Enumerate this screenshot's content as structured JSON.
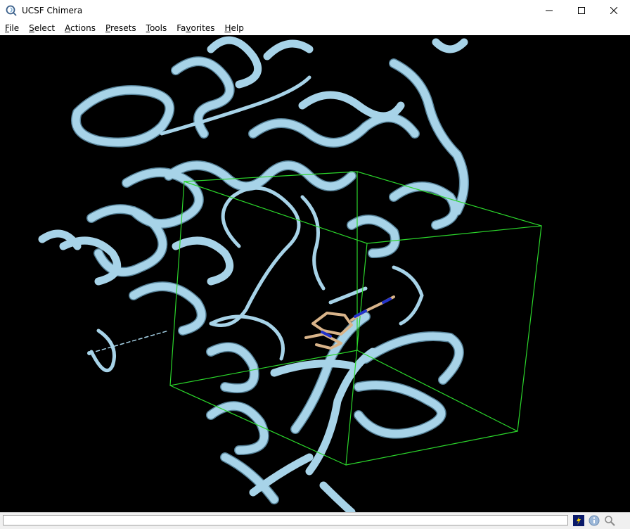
{
  "window": {
    "title": "UCSF Chimera",
    "icon": "chimera-logo-icon"
  },
  "window_controls": [
    "minimize-icon",
    "maximize-icon",
    "close-icon"
  ],
  "menu": {
    "items": [
      {
        "label": "File",
        "mnemonic": "F",
        "rest": "ile"
      },
      {
        "label": "Select",
        "mnemonic": "S",
        "rest": "elect"
      },
      {
        "label": "Actions",
        "mnemonic": "A",
        "rest": "ctions"
      },
      {
        "label": "Presets",
        "mnemonic": "P",
        "rest": "resets"
      },
      {
        "label": "Tools",
        "mnemonic": "T",
        "rest": "ools"
      },
      {
        "label": "Favorites",
        "pre": "Fa",
        "mnemonic": "v",
        "rest": "orites"
      },
      {
        "label": "Help",
        "mnemonic": "H",
        "rest": "elp"
      }
    ]
  },
  "viewer": {
    "background": "#000000",
    "ribbon_color": "#a7d3e8",
    "ribbon_shadow": "#5f8fa8",
    "box_color": "#2bd62b",
    "ligand_carbon": "#d9b48a",
    "ligand_nitrogen": "#2233cc"
  },
  "statusbar": {
    "message": "",
    "buttons": [
      "command-line-icon",
      "info-icon",
      "zoom-icon"
    ]
  }
}
